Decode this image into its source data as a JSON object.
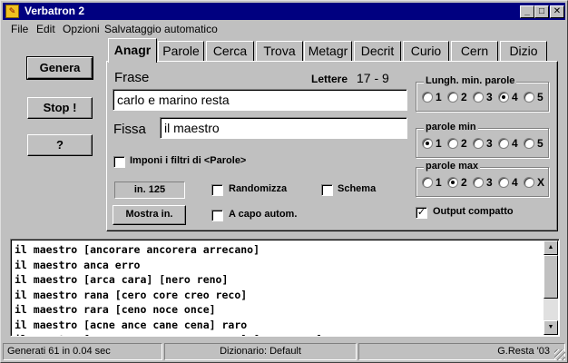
{
  "window": {
    "title": "Verbatron 2",
    "icon": "verbatron-app-icon",
    "minimize_glyph": "_",
    "maximize_glyph": "□",
    "close_glyph": "✕"
  },
  "menu": [
    "File",
    "Edit",
    "Opzioni",
    "Salvataggio automatico"
  ],
  "side_buttons": {
    "genera": "Genera",
    "stop": "Stop !",
    "help": "?"
  },
  "tabs": [
    "Anagr",
    "Parole",
    "Cerca",
    "Trova",
    "Metagr",
    "Decrit",
    "Curio",
    "Cern",
    "Dizio"
  ],
  "form": {
    "frase_label": "Frase",
    "lettere_label": "Lettere",
    "lettere_value": "17 - 9",
    "frase_value": "carlo e marino resta",
    "fissa_label": "Fissa",
    "fissa_value": "il maestro",
    "imponi_label": "Imponi i filtri di <Parole>",
    "imponi_checked": "",
    "counter": "in. 125",
    "mostra_label": "Mostra in.",
    "randomizza_label": "Randomizza",
    "randomizza_checked": "",
    "acapo_label": "A capo autom.",
    "acapo_checked": "",
    "schema_label": "Schema",
    "schema_checked": "",
    "output_compatto_label": "Output compatto",
    "output_compatto_checked": "✓"
  },
  "groups": {
    "lungh": {
      "title": "Lungh. min. parole",
      "options": [
        "1",
        "2",
        "3",
        "4",
        "5"
      ],
      "selected": 3
    },
    "pmin": {
      "title": "parole min",
      "options": [
        "1",
        "2",
        "3",
        "4",
        "5"
      ],
      "selected": 0
    },
    "pmax": {
      "title": "parole max",
      "options": [
        "1",
        "2",
        "3",
        "4",
        "X"
      ],
      "selected": 1
    }
  },
  "output_lines": [
    "il maestro [ancorare ancorera arrecano]",
    "il maestro anca erro",
    "il maestro [arca cara] [nero reno]",
    "il maestro rana [cero core creo reco]",
    "il maestro rara [ceno noce once]",
    "il maestro [acne ance cane cena] raro",
    "il maestro [acre care cera crea reca] [arno orna]"
  ],
  "status": {
    "generated": "Generati 61 in 0.04 sec",
    "dictionary": "Dizionario: Default",
    "credit": "G.Resta '03"
  }
}
